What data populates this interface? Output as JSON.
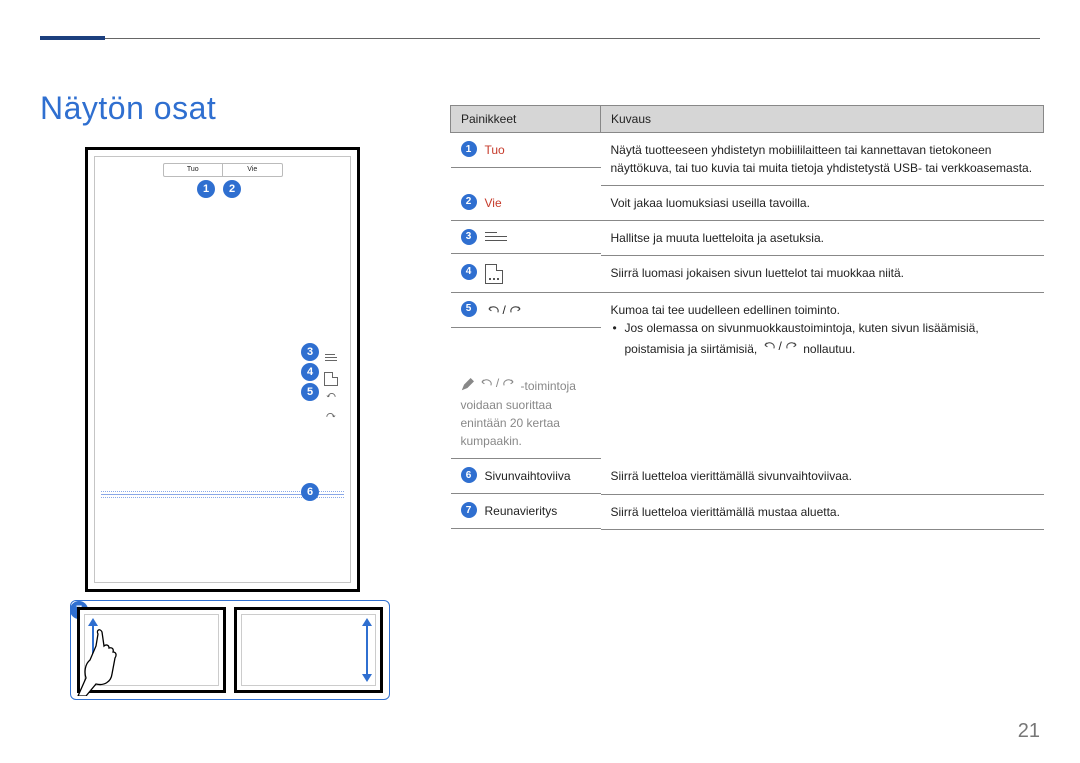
{
  "page_number": "21",
  "title": "Näytön osat",
  "diagram": {
    "tab_left": "Tuo",
    "tab_right": "Vie"
  },
  "table": {
    "headers": {
      "keys": "Painikkeet",
      "desc": "Kuvaus"
    },
    "rows": [
      {
        "num": "1",
        "label": "Tuo",
        "label_red": true,
        "icon": null,
        "desc_lines": [
          "Näytä tuotteeseen yhdistetyn mobiililaitteen tai kannettavan tietokoneen näyttökuva, tai tuo kuvia tai muita tietoja yhdistetystä USB- tai verkkoasemasta."
        ]
      },
      {
        "num": "2",
        "label": "Vie",
        "label_red": true,
        "icon": null,
        "desc_lines": [
          "Voit jakaa luomuksiasi useilla tavoilla."
        ]
      },
      {
        "num": "3",
        "label": "",
        "icon": "hamburger",
        "desc_lines": [
          "Hallitse ja muuta luetteloita ja asetuksia."
        ]
      },
      {
        "num": "4",
        "label": "",
        "icon": "page",
        "desc_lines": [
          "Siirrä luomasi jokaisen sivun luettelot tai muokkaa niitä."
        ]
      },
      {
        "num": "5",
        "label": "",
        "icon": "undo-redo",
        "desc_main": "Kumoa tai tee uudelleen edellinen toiminto.",
        "desc_bullet": "Jos olemassa on sivunmuokkaustoimintoja, kuten sivun lisäämisiä, poistamisia ja siirtämisiä, ",
        "desc_bullet_suffix": " nollautuu.",
        "note_suffix": "-toimintoja voidaan suorittaa enintään 20 kertaa kumpaakin."
      },
      {
        "num": "6",
        "label": "Sivunvaihtoviiva",
        "icon": null,
        "desc_lines": [
          "Siirrä luetteloa vierittämällä sivunvaihtoviivaa."
        ]
      },
      {
        "num": "7",
        "label": "Reunavieritys",
        "icon": null,
        "desc_lines": [
          "Siirrä luetteloa vierittämällä mustaa aluetta."
        ]
      }
    ]
  }
}
